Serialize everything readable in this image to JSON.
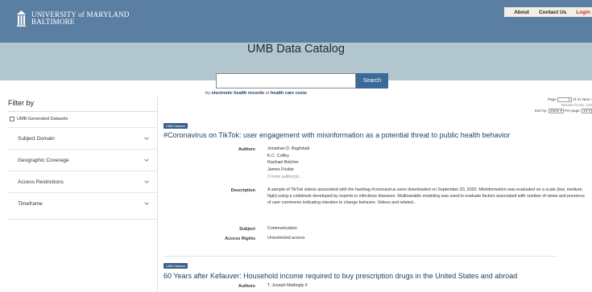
{
  "header": {
    "logo_line1": "UNIVERSITY of MARYLAND",
    "logo_line2": "BALTIMORE",
    "nav": [
      {
        "label": "About"
      },
      {
        "label": "Contact Us"
      },
      {
        "label": "Login"
      }
    ]
  },
  "hero": {
    "title": "UMB Data Catalog"
  },
  "search": {
    "value": "",
    "placeholder": "",
    "button_label": "Search",
    "try_prefix": "try",
    "suggestion_1": "electronic health records",
    "or_text": "or",
    "suggestion_2": "health care costs"
  },
  "sidebar": {
    "title": "Filter by",
    "checkbox_label": "UMB-Generated Datasets",
    "facets": [
      {
        "label": "Subject Domain"
      },
      {
        "label": "Geographic Coverage"
      },
      {
        "label": "Access Restrictions"
      },
      {
        "label": "Timeframe"
      }
    ]
  },
  "results_meta": {
    "page_label": "Page",
    "page_value": "1",
    "of_text": "of 21",
    "next_label": "Next ›",
    "found_text": "Results found: 210",
    "sortby_label": "Sort by:",
    "sortby_value": "name",
    "perpage_label": "Per page:",
    "perpage_value": "10"
  },
  "results": [
    {
      "badge": "UMB Dataset",
      "title": "#Coronavirus on TikTok: user engagement with misinformation as a potential threat to public health behavior",
      "authors_label": "Authors",
      "authors": [
        "Jonathan D. Baghdadi",
        "K.C. Coffey",
        "Rachael Belcher",
        "James Frisbie"
      ],
      "more_authors": "3 more author(s)...",
      "description_label": "Description",
      "description": "A sample of TikTok videos associated with the hashtag #coronavirus were downloaded on September 20, 2020. Misinformation was evaluated on a scale (low, medium, high) using a codebook developed by experts in infectious diseases. Multivariable modeling was used to evaluate factors associated with number of views and presence of user comments indicating intention to change behavior. Videos and related...",
      "subject_label": "Subject",
      "subject": "Communication",
      "access_label": "Access Rights",
      "access": "Unrestricted access"
    },
    {
      "badge": "UMB Dataset",
      "title": "60 Years after Kefauver: Household income required to buy prescription drugs in the United States and abroad",
      "authors_label": "Authors",
      "authors": [
        "T. Joseph Mattingly II"
      ]
    }
  ],
  "colors": {
    "header_bg": "#5b7fa3",
    "hero_bg": "#b2c6cd",
    "search_button": "#3a6a99",
    "badge_bg": "#3a5f86",
    "title_text": "#1f3d5a",
    "login_text": "#c22d2d"
  }
}
